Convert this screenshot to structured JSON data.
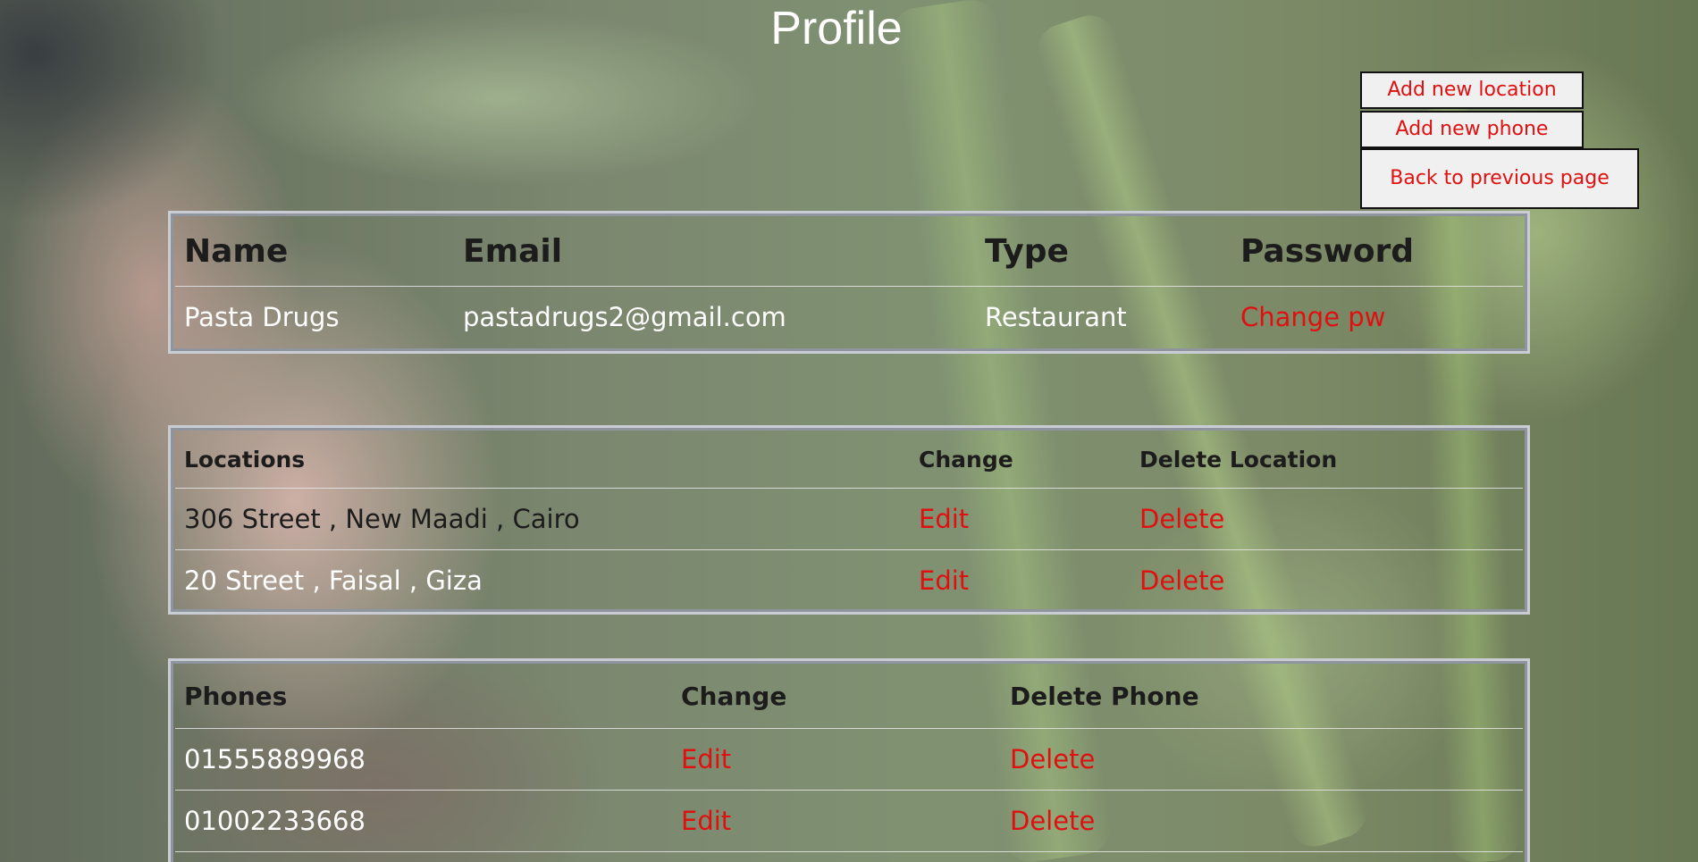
{
  "page": {
    "title": "Profile"
  },
  "actions": {
    "add_location": "Add new location",
    "add_phone": "Add new phone",
    "back": "Back to previous page"
  },
  "user_table": {
    "headers": [
      "Name",
      "Email",
      "Type",
      "Password"
    ],
    "row": {
      "name": "Pasta Drugs",
      "email": "pastadrugs2@gmail.com",
      "type": "Restaurant",
      "password_action": "Change pw"
    }
  },
  "locations_table": {
    "headers": [
      "Locations",
      "Change",
      "Delete Location"
    ],
    "rows": [
      {
        "location": "306 Street , New Maadi , Cairo",
        "edit": "Edit",
        "delete": "Delete"
      },
      {
        "location": "20 Street , Faisal , Giza",
        "edit": "Edit",
        "delete": "Delete"
      }
    ]
  },
  "phones_table": {
    "headers": [
      "Phones",
      "Change",
      "Delete Phone"
    ],
    "rows": [
      {
        "phone": "01555889968",
        "edit": "Edit",
        "delete": "Delete"
      },
      {
        "phone": "01002233668",
        "edit": "Edit",
        "delete": "Delete"
      }
    ]
  },
  "colors": {
    "link": "#e01010",
    "header_text": "#1c1c1c",
    "cell_text": "#ffffff",
    "button_bg": "#f0f0f0"
  }
}
